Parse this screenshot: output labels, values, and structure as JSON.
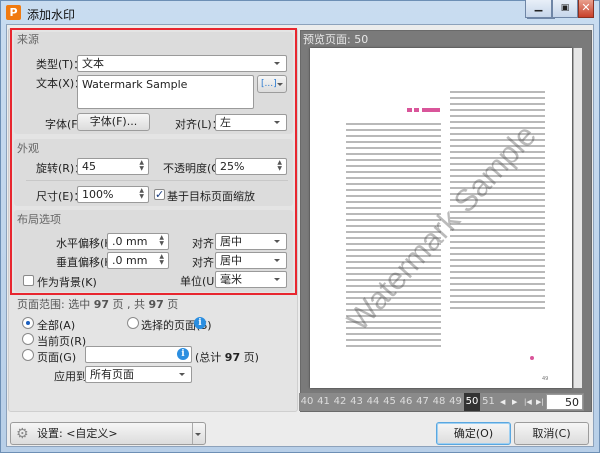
{
  "window": {
    "title": "添加水印",
    "app_icon": "P"
  },
  "source": {
    "header": "来源",
    "type_label": "类型(T)：",
    "type_value": "文本",
    "text_label": "文本(X)：",
    "text_value": "Watermark Sample",
    "insert_button": "[...]",
    "font_label": "字体(F):",
    "font_button": "字体(F)...",
    "align_label": "对齐(L)：",
    "align_value": "左"
  },
  "appearance": {
    "header": "外观",
    "rotation_label": "旋转(R)：",
    "rotation_value": "45",
    "opacity_label": "不透明度(O):",
    "opacity_value": "25%",
    "size_label": "尺寸(E)：",
    "size_value": "100%",
    "scale_label": "基于目标页面缩放",
    "scale_checked": true
  },
  "layout": {
    "header": "布局选项",
    "h_offset_label": "水平偏移(H):",
    "h_offset_value": ".0 mm",
    "h_align_label": "对齐:",
    "h_align_value": "居中",
    "v_offset_label": "垂直偏移(H):",
    "v_offset_value": ".0 mm",
    "v_align_label": "对齐:",
    "v_align_value": "居中",
    "background_label": "作为背景(K)",
    "unit_label": "单位(U):",
    "unit_value": "毫米"
  },
  "page_range": {
    "header_prefix": "页面范围: 选中 ",
    "selected": "97",
    "header_mid": " 页 , 共 ",
    "total": "97",
    "header_suffix": " 页",
    "all_label": "全部(A)",
    "selected_pages_label": "选择的页面(S)",
    "current_label": "当前页(R)",
    "pages_label": "页面(G)",
    "pages_value": "",
    "total_prefix": "(总计 ",
    "total_count": "97",
    "total_suffix": " 页)",
    "apply_label": "应用到:",
    "apply_value": "所有页面",
    "info_icon": "i"
  },
  "preview": {
    "header": "预览页面: 50",
    "pages": [
      "40",
      "41",
      "42",
      "43",
      "44",
      "45",
      "46",
      "47",
      "48",
      "49",
      "50",
      "51"
    ],
    "current_page": "50",
    "page_input": "50",
    "page_footer": "49"
  },
  "footer": {
    "settings_label": "设置: <自定义>",
    "ok": "确定(O)",
    "cancel": "取消(C)"
  },
  "colors": {
    "accent": "#e8262f",
    "pink": "#d9559a"
  }
}
